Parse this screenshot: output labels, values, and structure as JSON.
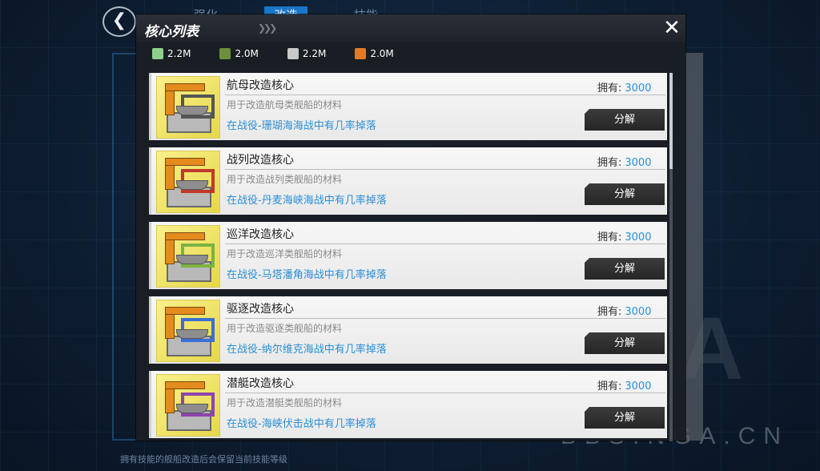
{
  "background": {
    "back_glyph": "❮",
    "tabs": [
      "强化",
      "改造",
      "技能"
    ],
    "active_tab_index": 1,
    "bottom_hint": "拥有技能的舰船改造后会保留当前技能等级",
    "watermark": "NGA",
    "watermark_url": "BBS.NGA.CN"
  },
  "modal": {
    "title": "核心列表",
    "close_glyph": "✕",
    "resources": [
      {
        "icon": "fuel-icon",
        "color": "#8fcf8a",
        "value": "2.2M"
      },
      {
        "icon": "ammo-icon",
        "color": "#6b8f3a",
        "value": "2.0M"
      },
      {
        "icon": "steel-icon",
        "color": "#c9c9c9",
        "value": "2.2M"
      },
      {
        "icon": "aluminum-icon",
        "color": "#e07a2a",
        "value": "2.0M"
      }
    ],
    "owned_label": "拥有:",
    "decompose_label": "分解",
    "cores": [
      {
        "name": "航母改造核心",
        "desc": "用于改造航母类舰船的材料",
        "source": "在战役-珊瑚海海战中有几率掉落",
        "owned": "3000",
        "frame_color": "#555555"
      },
      {
        "name": "战列改造核心",
        "desc": "用于改造战列类舰船的材料",
        "source": "在战役-丹麦海峡海战中有几率掉落",
        "owned": "3000",
        "frame_color": "#c0392b"
      },
      {
        "name": "巡洋改造核心",
        "desc": "用于改造巡洋类舰船的材料",
        "source": "在战役-马塔潘角海战中有几率掉落",
        "owned": "3000",
        "frame_color": "#7cb342"
      },
      {
        "name": "驱逐改造核心",
        "desc": "用于改造驱逐类舰船的材料",
        "source": "在战役-纳尔维克海战中有几率掉落",
        "owned": "3000",
        "frame_color": "#3b6fd1"
      },
      {
        "name": "潜艇改造核心",
        "desc": "用于改造潜艇类舰船的材料",
        "source": "在战役-海峡伏击战中有几率掉落",
        "owned": "3000",
        "frame_color": "#8e44ad"
      }
    ]
  }
}
